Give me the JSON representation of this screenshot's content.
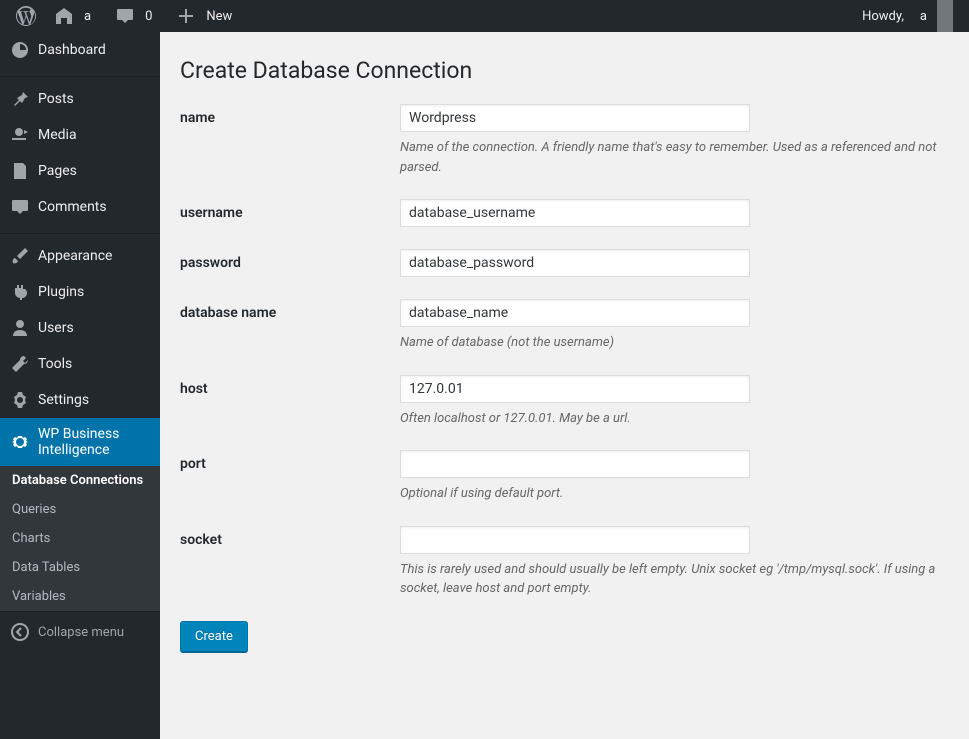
{
  "adminbar": {
    "site_name": "a",
    "comment_count": "0",
    "new_label": "New",
    "howdy_prefix": "Howdy,",
    "howdy_user": "a"
  },
  "sidebar": {
    "items": [
      {
        "label": "Dashboard",
        "icon": "dashboard"
      },
      {
        "label": "Posts",
        "icon": "pin"
      },
      {
        "label": "Media",
        "icon": "media"
      },
      {
        "label": "Pages",
        "icon": "page"
      },
      {
        "label": "Comments",
        "icon": "comment"
      },
      {
        "label": "Appearance",
        "icon": "brush"
      },
      {
        "label": "Plugins",
        "icon": "plugin"
      },
      {
        "label": "Users",
        "icon": "user"
      },
      {
        "label": "Tools",
        "icon": "wrench"
      },
      {
        "label": "Settings",
        "icon": "settings"
      },
      {
        "label": "WP Business Intelligence",
        "icon": "gear"
      }
    ],
    "submenu": [
      "Database Connections",
      "Queries",
      "Charts",
      "Data Tables",
      "Variables"
    ],
    "collapse_label": "Collapse menu"
  },
  "page": {
    "title": "Create Database Connection",
    "fields": {
      "name": {
        "label": "name",
        "value": "Wordpress",
        "desc": "Name of the connection. A friendly name that's easy to remember. Used as a referenced and not parsed."
      },
      "username": {
        "label": "username",
        "value": "database_username",
        "desc": ""
      },
      "password": {
        "label": "password",
        "value": "database_password",
        "desc": ""
      },
      "dbname": {
        "label": "database name",
        "value": "database_name",
        "desc": "Name of database (not the username)"
      },
      "host": {
        "label": "host",
        "value": "127.0.01",
        "desc": "Often localhost or 127.0.01. May be a url."
      },
      "port": {
        "label": "port",
        "value": "",
        "desc": "Optional if using default port."
      },
      "socket": {
        "label": "socket",
        "value": "",
        "desc": "This is rarely used and should usually be left empty. Unix socket eg '/tmp/mysql.sock'. If using a socket, leave host and port empty."
      }
    },
    "submit_label": "Create"
  }
}
